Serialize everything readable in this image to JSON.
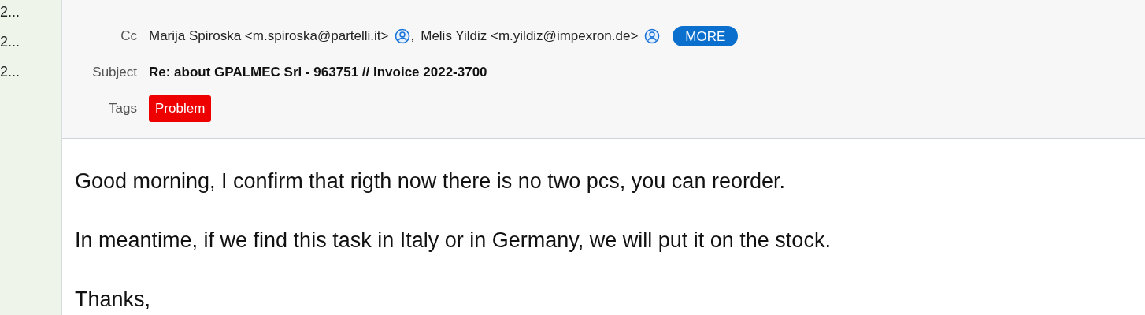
{
  "message_list": {
    "items": [
      {
        "text": "2..."
      },
      {
        "text": "2..."
      },
      {
        "text": "2..."
      }
    ]
  },
  "header": {
    "cc": {
      "label": "Cc",
      "recipients": [
        "Marija Spiroska <m.spiroska@partelli.it>",
        "Melis Yildiz <m.yildiz@impexron.de>"
      ],
      "separator": ",",
      "more": "MORE"
    },
    "subject": {
      "label": "Subject",
      "value": "Re: about GPALMEC Srl - 963751 // Invoice 2022-3700"
    },
    "tags": {
      "label": "Tags",
      "items": [
        {
          "text": "Problem",
          "color": "#ee0000"
        }
      ]
    }
  },
  "body": {
    "paragraphs": [
      "Good morning, I confirm that rigth now there is no two pcs, you can reorder.",
      "In meantime, if we find this task in Italy or in Germany, we will put it on the stock.",
      "Thanks,"
    ]
  }
}
